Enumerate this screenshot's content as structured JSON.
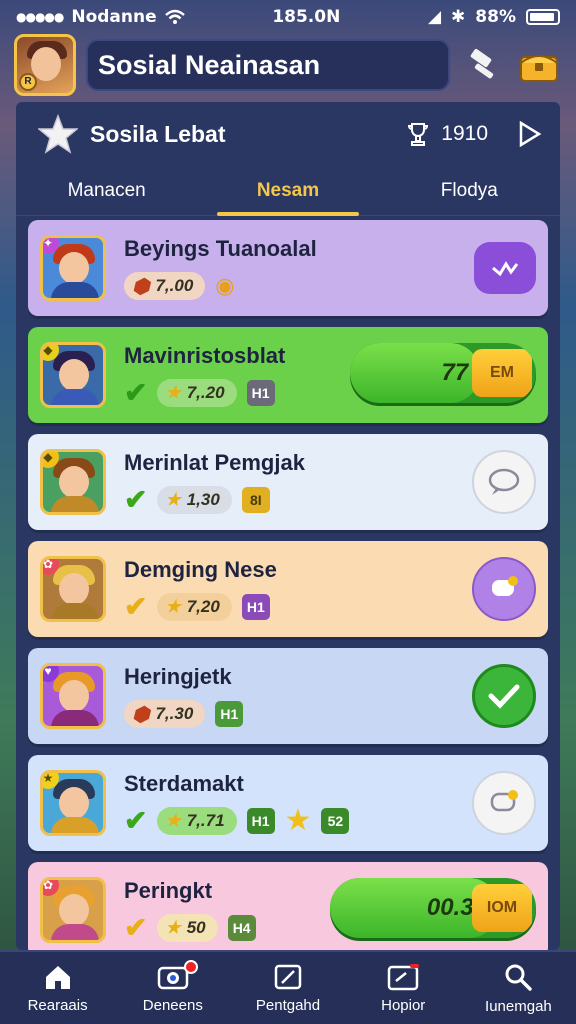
{
  "status_bar": {
    "carrier": "Nodanne",
    "time": "185.0N",
    "battery": "88%"
  },
  "top_bar": {
    "title": "Sosial Neainasan"
  },
  "header": {
    "title": "Sosila Lebat",
    "points": "1910"
  },
  "tabs": [
    {
      "label": "Manacen",
      "active": false
    },
    {
      "label": "Nesam",
      "active": true
    },
    {
      "label": "Flodya",
      "active": false
    }
  ],
  "friends": [
    {
      "name": "Beyings Tuanoalal",
      "score": "7,.00",
      "bg": "#c7b0ec",
      "chip_bg": "#f1d6c4",
      "level": "",
      "action": "chat-icon",
      "action_bg": "#8a4ed8"
    },
    {
      "name": "Mavinristosblat",
      "score": "7,.20",
      "bg": "#6cd14a",
      "chip_bg": "#9bdc7e",
      "level": "H1",
      "progress_value": "77",
      "progress_cap": "EM",
      "progress_fraction": 0.7
    },
    {
      "name": "Merinlat Pemgjak",
      "score": "1,30",
      "bg": "#e6eefa",
      "chip_bg": "#d9dde6",
      "level": "8I",
      "action": "chat-bubble-icon",
      "action_bg": "#f4f4f4"
    },
    {
      "name": "Demging Nese",
      "score": "7,20",
      "bg": "#fbdcb2",
      "chip_bg": "#f3cf9c",
      "level": "H1",
      "action": "speech-icon",
      "action_bg": "#b082e8"
    },
    {
      "name": "Heringjetk",
      "score": "7,.30",
      "bg": "#c8d7f4",
      "chip_bg": "#f1d6c4",
      "level": "H1",
      "action": "check-icon",
      "action_bg": "#3bb53a"
    },
    {
      "name": "Sterdamakt",
      "score": "7,.71",
      "bg": "#d3e3fb",
      "chip_bg": "#9bdc7e",
      "level": "H1",
      "extra": "52",
      "action": "speech-icon",
      "action_bg": "#f4f4f4"
    },
    {
      "name": "Peringkt",
      "score": "50",
      "bg": "#f8c8df",
      "chip_bg": "#f3e3b5",
      "level": "H4",
      "progress_value": "00.33",
      "progress_cap": "IOM",
      "progress_fraction": 0.82
    }
  ],
  "bottom_nav": [
    {
      "label": "Rearaais",
      "icon": "home-icon"
    },
    {
      "label": "Deneens",
      "icon": "camera-icon"
    },
    {
      "label": "Pentgahd",
      "icon": "edit-icon"
    },
    {
      "label": "Hopior",
      "icon": "card-icon"
    },
    {
      "label": "Iunemgah",
      "icon": "search-icon"
    }
  ]
}
